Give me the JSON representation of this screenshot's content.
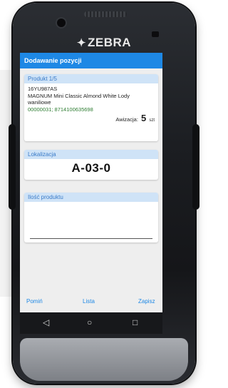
{
  "device": {
    "brand_logo": "ZEBRA",
    "logo_icon": "zebra-head-icon"
  },
  "app": {
    "title": "Dodawanie pozycji"
  },
  "product_card": {
    "header": "Produkt 1/5",
    "code": "16YU987AS",
    "name_line1": "MAGNUM Mini Classic Almond White Lody",
    "name_line2": "waniliowe",
    "barcodes": "00000031; 8714100635698",
    "notice_label": "Awizacja:",
    "notice_qty": "5",
    "notice_unit": "szt"
  },
  "location_card": {
    "header": "Lokalizacja",
    "value": "A-03-0"
  },
  "quantity_card": {
    "header": "Ilość produktu",
    "input_value": ""
  },
  "actions": {
    "skip": "Pomiń",
    "list": "Lista",
    "save": "Zapisz"
  },
  "navbar": {
    "back_icon": "back-icon",
    "home_icon": "home-icon",
    "recents_icon": "recents-icon"
  },
  "colors": {
    "primary": "#1e88e5",
    "card_header_bg": "#cfe3f7",
    "barcode_green": "#2e7d32"
  }
}
